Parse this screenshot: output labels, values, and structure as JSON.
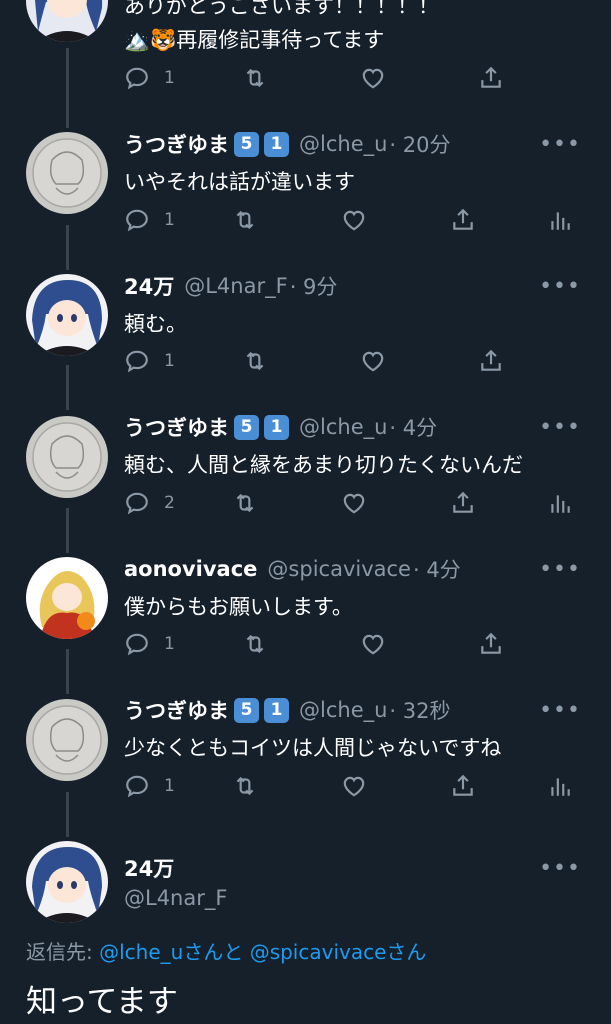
{
  "tweets": [
    {
      "text": "ありがとうございます！！！！！",
      "text2": "🏔️🐯再履修記事待ってます",
      "reply_count": "1"
    },
    {
      "name": "うつぎゆま",
      "badges": [
        "5",
        "1"
      ],
      "handle": "@lche_u",
      "time": "· 20分",
      "text": "いやそれは話が違います",
      "reply_count": "1"
    },
    {
      "name": "24万",
      "handle": "@L4nar_F",
      "time": "· 9分",
      "text": "頼む。",
      "reply_count": "1"
    },
    {
      "name": "うつぎゆま",
      "badges": [
        "5",
        "1"
      ],
      "handle": "@lche_u",
      "time": "· 4分",
      "text": "頼む、人間と縁をあまり切りたくないんだ",
      "reply_count": "2"
    },
    {
      "name": "aonovivace",
      "handle": "@spicavivace",
      "time": "· 4分",
      "text": "僕からもお願いします。",
      "reply_count": "1"
    },
    {
      "name": "うつぎゆま",
      "badges": [
        "5",
        "1"
      ],
      "handle": "@lche_u",
      "time": "· 32秒",
      "text": "少なくともコイツは人間じゃないですね",
      "reply_count": "1"
    }
  ],
  "compose": {
    "name": "24万",
    "handle": "@L4nar_F",
    "reply_prefix": "返信先:",
    "reply_user1": "@lche_u",
    "reply_and": "さんと",
    "reply_user2": "@spicavivace",
    "reply_suffix": "さん",
    "text": "知ってます"
  },
  "icons": {
    "reply": "reply-icon",
    "retweet": "retweet-icon",
    "like": "heart-icon",
    "share": "share-icon",
    "analytics": "analytics-icon",
    "more": "more-dots-icon"
  },
  "colors": {
    "background": "#15202b",
    "secondary_text": "#8b98a5",
    "link": "#1d9bf0",
    "badge": "#4a8fd6"
  }
}
